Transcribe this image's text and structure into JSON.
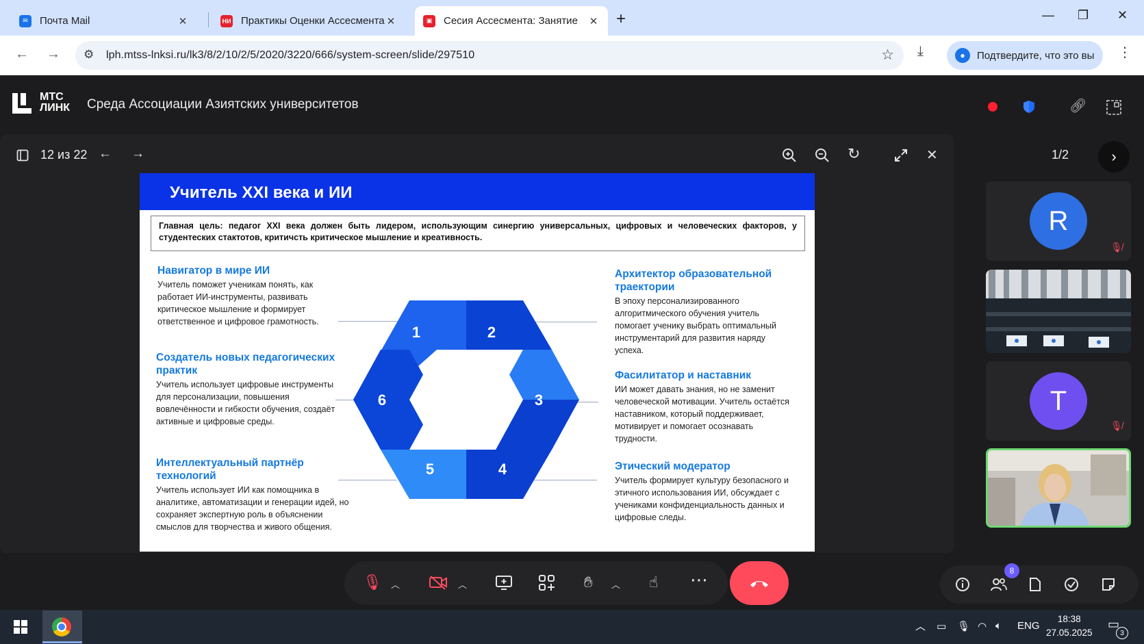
{
  "browser": {
    "tabs": [
      {
        "title": "Почта Mail",
        "close": "✕",
        "favicon_color": "#1a73e8"
      },
      {
        "title": "Практикы Оценки Ассесмента",
        "close": "✕",
        "favicon_color": "#e5222d",
        "favicon_text": "НИ"
      },
      {
        "title": "Сесия Ассесмента: Занятие",
        "close": "✕",
        "favicon_color": "#e5222d",
        "active": true
      }
    ],
    "new_tab": "+",
    "window_controls": {
      "minimize": "—",
      "restore": "❐",
      "close": "✕"
    },
    "back": "←",
    "forward": "→",
    "url": "lph.mtss-lnksi.ru/lk3/8/2/10/2/5/2020/3220/666/system-screen/slide/297510",
    "download_icon": "⤓",
    "profile_label": "Подтвердите, что это вы",
    "menu": "⋮"
  },
  "app": {
    "logo_line1": "МТС",
    "logo_line2": "ЛИНК",
    "room_title": "Среда Ассоциации Азиятских университетов",
    "accent": "#0a32e6"
  },
  "stage": {
    "page_counter": "12 из 22"
  },
  "slide": {
    "title": "Учитель XXI века и ИИ",
    "goal": "Главная цель: педагог XXI века должен быть лидером, использующим синергию универсальных, цифровых и человеческих факторов, у студентеских стактотов, критичсть критическое мышление и креативность.",
    "hex_numbers": [
      "1",
      "2",
      "3",
      "4",
      "5",
      "6"
    ],
    "roles_left": [
      {
        "title": "Навигатор в мире ИИ",
        "desc": "Учитель поможет ученикам понять, как работает ИИ-инструменты, развивать критическое мышление и формирует ответственное и цифровое грамотность."
      },
      {
        "title": "Создатель новых педагогических практик",
        "desc": "Учитель использует цифровые инструменты для персонализации, повышения вовлечённости и гибкости обучения, создаёт активные и цифровые среды."
      },
      {
        "title": "Интеллектуальный партнёр технологий",
        "desc": "Учитель использует ИИ как помощника в аналитике, автоматизации и генерации идей, но сохраняет экспертную роль в объяснении смыслов для творчества и живого общения."
      }
    ],
    "roles_right": [
      {
        "title": "Архитектор образовательной траектории",
        "desc": "В эпоху персонализированного алгоритмического обучения учитель помогает ученику выбрать оптимальный инструментарий для развития наряду успеха."
      },
      {
        "title": "Фасилитатор и наставник",
        "desc": "ИИ может давать знания, но не заменит человеческой мотивации. Учитель остаётся наставником, который поддерживает, мотивирует и помогает осознавать трудности."
      },
      {
        "title": "Этический модератор",
        "desc": "Учитель формирует культуру безопасного и этичного использования ИИ, обсуждает с учениками конфиденциальность данных и цифровые следы."
      }
    ],
    "hex_colors": [
      "#1d63ee",
      "#0a42d4",
      "#2a7cf5",
      "#0b3fd0",
      "#2f8bf7",
      "#0c46d8"
    ]
  },
  "sidebar": {
    "page_counter": "1/2",
    "participants": [
      {
        "initial": "R",
        "color": "#2f6fe4",
        "muted": true
      },
      {
        "initial": "",
        "kind": "video-conference-room"
      },
      {
        "initial": "T",
        "color": "#6f4ff0",
        "muted": true
      },
      {
        "initial": "",
        "kind": "video-speaker",
        "active": true
      }
    ]
  },
  "controls": {
    "participants_count": "8"
  },
  "taskbar": {
    "lang": "ENG",
    "time": "18:38",
    "date": "27.05.2025",
    "notifications": "3"
  }
}
